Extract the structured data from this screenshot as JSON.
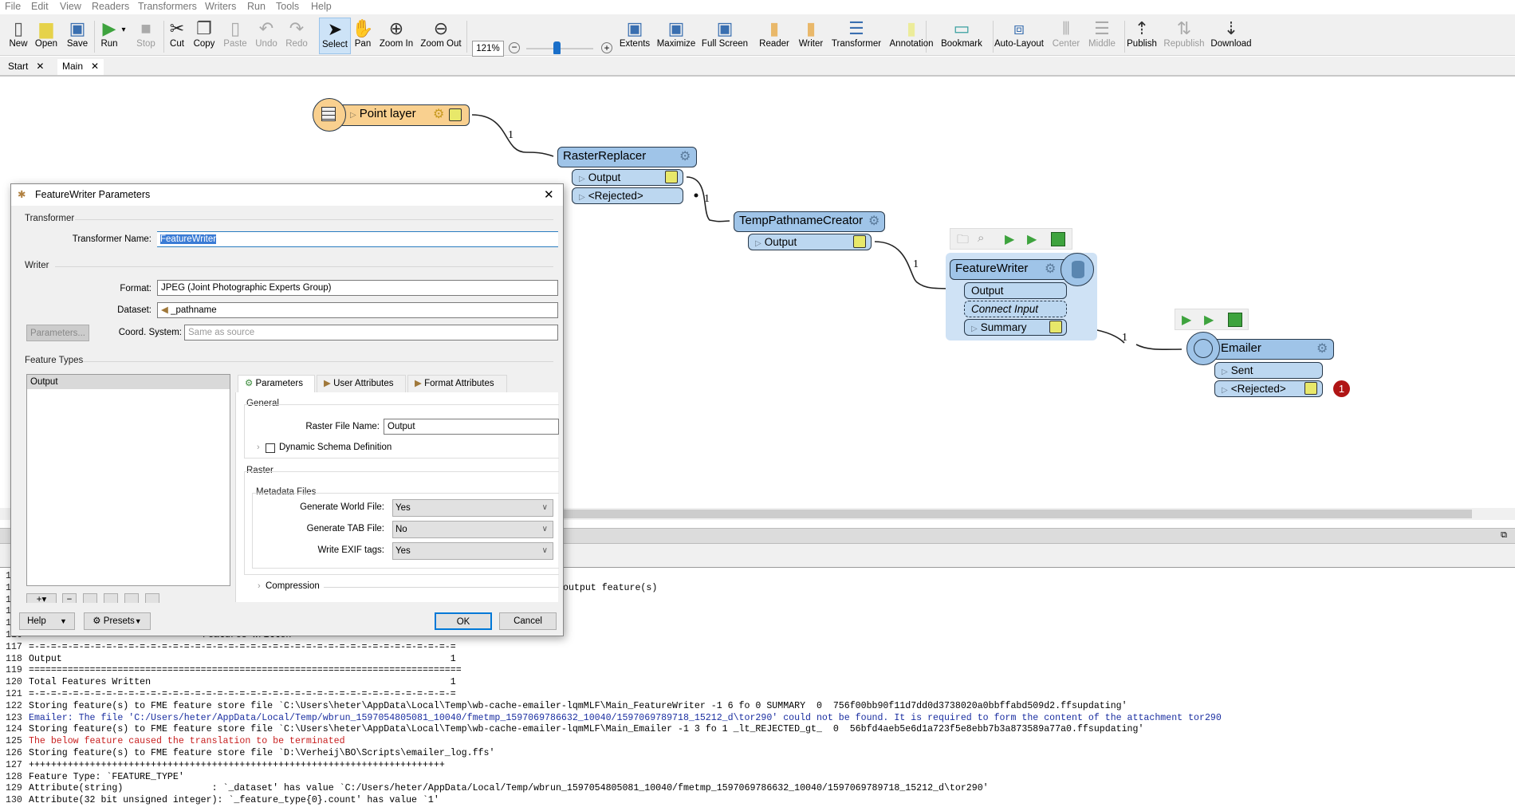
{
  "menu": [
    "File",
    "Edit",
    "View",
    "Readers",
    "Transformers",
    "Writers",
    "Run",
    "Tools",
    "Help"
  ],
  "toolbar": {
    "items": [
      {
        "label": "New",
        "icon": "new-file-icon",
        "disabled": false
      },
      {
        "label": "Open",
        "icon": "folder-icon",
        "disabled": false
      },
      {
        "label": "Save",
        "icon": "save-icon",
        "disabled": false
      },
      {
        "label": "Run",
        "icon": "run-icon",
        "disabled": false
      },
      {
        "label": "Stop",
        "icon": "stop-icon",
        "disabled": true
      },
      {
        "label": "Cut",
        "icon": "scissors-icon",
        "disabled": false
      },
      {
        "label": "Copy",
        "icon": "copy-icon",
        "disabled": false
      },
      {
        "label": "Paste",
        "icon": "paste-icon",
        "disabled": true
      },
      {
        "label": "Undo",
        "icon": "undo-icon",
        "disabled": true
      },
      {
        "label": "Redo",
        "icon": "redo-icon",
        "disabled": true
      },
      {
        "label": "Select",
        "icon": "cursor-icon",
        "disabled": false,
        "selected": true
      },
      {
        "label": "Pan",
        "icon": "hand-icon",
        "disabled": false
      },
      {
        "label": "Zoom In",
        "icon": "zoom-in-icon",
        "disabled": false
      },
      {
        "label": "Zoom Out",
        "icon": "zoom-out-icon",
        "disabled": false
      },
      {
        "label": "Extents",
        "icon": "extents-icon",
        "disabled": false
      },
      {
        "label": "Maximize",
        "icon": "maximize-icon",
        "disabled": false
      },
      {
        "label": "Full Screen",
        "icon": "fullscreen-icon",
        "disabled": false
      },
      {
        "label": "Reader",
        "icon": "add-reader-icon",
        "disabled": false
      },
      {
        "label": "Writer",
        "icon": "add-writer-icon",
        "disabled": false
      },
      {
        "label": "Transformer",
        "icon": "add-transformer-icon",
        "disabled": false
      },
      {
        "label": "Annotation",
        "icon": "annotation-icon",
        "disabled": false
      },
      {
        "label": "Bookmark",
        "icon": "bookmark-icon",
        "disabled": false
      },
      {
        "label": "Auto-Layout",
        "icon": "auto-layout-icon",
        "disabled": false
      },
      {
        "label": "Center",
        "icon": "align-center-icon",
        "disabled": true
      },
      {
        "label": "Middle",
        "icon": "align-middle-icon",
        "disabled": true
      },
      {
        "label": "Publish",
        "icon": "publish-icon",
        "disabled": false
      },
      {
        "label": "Republish",
        "icon": "republish-icon",
        "disabled": true
      },
      {
        "label": "Download",
        "icon": "download-icon",
        "disabled": false
      }
    ],
    "zoom_level": "121%",
    "zoom_slider_percent": 45
  },
  "tabs": [
    {
      "label": "Start"
    },
    {
      "label": "Main",
      "active": true
    }
  ],
  "canvas": {
    "reader": {
      "name": "Point layer"
    },
    "raster_replacer": {
      "name": "RasterReplacer",
      "ports": [
        "Output",
        "<Rejected>"
      ]
    },
    "temp_pathname": {
      "name": "TempPathnameCreator",
      "ports": [
        "Output"
      ]
    },
    "feature_writer": {
      "name": "FeatureWriter",
      "ports": [
        "Output",
        "Connect Input",
        "Summary"
      ]
    },
    "emailer": {
      "name": "Emailer",
      "ports": [
        "Sent",
        "<Rejected>"
      ],
      "rejected_count": "1"
    },
    "link_counts": [
      "1",
      "1",
      "1",
      "1"
    ]
  },
  "log": {
    "lines": [
      {
        "n": "111",
        "t": ""
      },
      {
        "n": "112",
        "t": "output feature(s)",
        "indent": true
      },
      {
        "n": "113",
        "t": ""
      },
      {
        "n": "114",
        "t": ""
      },
      {
        "n": "115",
        "t": ""
      },
      {
        "n": "116",
        "t": "Features Written",
        "indent2": true
      },
      {
        "n": "117",
        "t": "=-=-=-=-=-=-=-=-=-=-=-=-=-=-=-=-=-=-=-=-=-=-=-=-=-=-=-=-=-=-=-=-=-=-=-=-=-=-="
      },
      {
        "n": "118",
        "t": "Output                                                                      1"
      },
      {
        "n": "119",
        "t": "=============================================================================="
      },
      {
        "n": "120",
        "t": "Total Features Written                                                      1"
      },
      {
        "n": "121",
        "t": "=-=-=-=-=-=-=-=-=-=-=-=-=-=-=-=-=-=-=-=-=-=-=-=-=-=-=-=-=-=-=-=-=-=-=-=-=-=-="
      },
      {
        "n": "122",
        "t": "Storing feature(s) to FME feature store file `C:\\Users\\heter\\AppData\\Local\\Temp\\wb-cache-emailer-lqmMLF\\Main_FeatureWriter -1 6 fo 0 SUMMARY  0  756f00bb90f11d7dd0d3738020a0bbffabd509d2.ffsupdating'"
      },
      {
        "n": "123",
        "t": "Emailer: The file 'C:/Users/heter/AppData/Local/Temp/wbrun_1597054805081_10040/fmetmp_1597069786632_10040/1597069789718_15212_d\\tor290' could not be found. It is required to form the content of the attachment tor290",
        "style": "blue"
      },
      {
        "n": "124",
        "t": "Storing feature(s) to FME feature store file `C:\\Users\\heter\\AppData\\Local\\Temp\\wb-cache-emailer-lqmMLF\\Main_Emailer -1 3 fo 1 _lt_REJECTED_gt_  0  56bfd4aeb5e6d1a723f5e8ebb7b3a873589a77a0.ffsupdating'"
      },
      {
        "n": "125",
        "t": "The below feature caused the translation to be terminated",
        "style": "red"
      },
      {
        "n": "126",
        "t": "Storing feature(s) to FME feature store file `D:\\Verheij\\BO\\Scripts\\emailer_log.ffs'"
      },
      {
        "n": "127",
        "t": "+++++++++++++++++++++++++++++++++++++++++++++++++++++++++++++++++++++++++++"
      },
      {
        "n": "128",
        "t": "Feature Type: `FEATURE_TYPE'"
      },
      {
        "n": "129",
        "t": "Attribute(string)                : `_dataset' has value `C:/Users/heter/AppData/Local/Temp/wbrun_1597054805081_10040/fmetmp_1597069786632_10040/1597069789718_15212_d\\tor290'"
      },
      {
        "n": "130",
        "t": "Attribute(32 bit unsigned integer): `_feature_type{0}.count' has value `1'"
      }
    ]
  },
  "dialog": {
    "title": "FeatureWriter Parameters",
    "transformer_group": "Transformer",
    "transformer_name_label": "Transformer Name:",
    "transformer_name_value": "FeatureWriter",
    "writer_group": "Writer",
    "format_label": "Format:",
    "format_value": "JPEG (Joint Photographic Experts Group)",
    "dataset_label": "Dataset:",
    "dataset_value": "_pathname",
    "parameters_button": "Parameters...",
    "coord_label": "Coord. System:",
    "coord_placeholder": "Same as source",
    "feature_types_group": "Feature Types",
    "feature_types": [
      "Output"
    ],
    "tabs": [
      "Parameters",
      "User Attributes",
      "Format Attributes"
    ],
    "general_group": "General",
    "raster_file_label": "Raster File Name:",
    "raster_file_value": "Output",
    "dynamic_schema_label": "Dynamic Schema Definition",
    "dynamic_schema_checked": false,
    "raster_group": "Raster",
    "metadata_group": "Metadata Files",
    "world_file_label": "Generate World File:",
    "world_file_value": "Yes",
    "tab_file_label": "Generate TAB File:",
    "tab_file_value": "No",
    "exif_label": "Write EXIF tags:",
    "exif_value": "Yes",
    "compression_label": "Compression",
    "help_button": "Help",
    "presets_button": "Presets",
    "ok_button": "OK",
    "cancel_button": "Cancel"
  },
  "colors": {
    "node_blue": "#9fc4e8",
    "port_blue": "#bcd7f0",
    "reader_orange": "#f9d08f",
    "inspector_yellow": "#e8e86a",
    "error_red": "#b01515",
    "log_blue": "#1a2ea0",
    "log_red": "#c81e1e"
  }
}
